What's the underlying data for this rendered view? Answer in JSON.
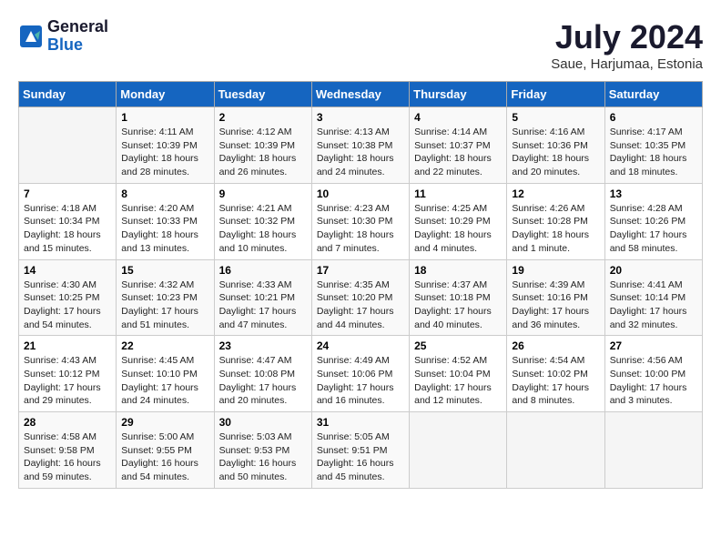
{
  "logo": {
    "line1": "General",
    "line2": "Blue"
  },
  "title": "July 2024",
  "location": "Saue, Harjumaa, Estonia",
  "days_header": [
    "Sunday",
    "Monday",
    "Tuesday",
    "Wednesday",
    "Thursday",
    "Friday",
    "Saturday"
  ],
  "weeks": [
    [
      {
        "day": "",
        "sunrise": "",
        "sunset": "",
        "daylight": ""
      },
      {
        "day": "1",
        "sunrise": "Sunrise: 4:11 AM",
        "sunset": "Sunset: 10:39 PM",
        "daylight": "Daylight: 18 hours and 28 minutes."
      },
      {
        "day": "2",
        "sunrise": "Sunrise: 4:12 AM",
        "sunset": "Sunset: 10:39 PM",
        "daylight": "Daylight: 18 hours and 26 minutes."
      },
      {
        "day": "3",
        "sunrise": "Sunrise: 4:13 AM",
        "sunset": "Sunset: 10:38 PM",
        "daylight": "Daylight: 18 hours and 24 minutes."
      },
      {
        "day": "4",
        "sunrise": "Sunrise: 4:14 AM",
        "sunset": "Sunset: 10:37 PM",
        "daylight": "Daylight: 18 hours and 22 minutes."
      },
      {
        "day": "5",
        "sunrise": "Sunrise: 4:16 AM",
        "sunset": "Sunset: 10:36 PM",
        "daylight": "Daylight: 18 hours and 20 minutes."
      },
      {
        "day": "6",
        "sunrise": "Sunrise: 4:17 AM",
        "sunset": "Sunset: 10:35 PM",
        "daylight": "Daylight: 18 hours and 18 minutes."
      }
    ],
    [
      {
        "day": "7",
        "sunrise": "Sunrise: 4:18 AM",
        "sunset": "Sunset: 10:34 PM",
        "daylight": "Daylight: 18 hours and 15 minutes."
      },
      {
        "day": "8",
        "sunrise": "Sunrise: 4:20 AM",
        "sunset": "Sunset: 10:33 PM",
        "daylight": "Daylight: 18 hours and 13 minutes."
      },
      {
        "day": "9",
        "sunrise": "Sunrise: 4:21 AM",
        "sunset": "Sunset: 10:32 PM",
        "daylight": "Daylight: 18 hours and 10 minutes."
      },
      {
        "day": "10",
        "sunrise": "Sunrise: 4:23 AM",
        "sunset": "Sunset: 10:30 PM",
        "daylight": "Daylight: 18 hours and 7 minutes."
      },
      {
        "day": "11",
        "sunrise": "Sunrise: 4:25 AM",
        "sunset": "Sunset: 10:29 PM",
        "daylight": "Daylight: 18 hours and 4 minutes."
      },
      {
        "day": "12",
        "sunrise": "Sunrise: 4:26 AM",
        "sunset": "Sunset: 10:28 PM",
        "daylight": "Daylight: 18 hours and 1 minute."
      },
      {
        "day": "13",
        "sunrise": "Sunrise: 4:28 AM",
        "sunset": "Sunset: 10:26 PM",
        "daylight": "Daylight: 17 hours and 58 minutes."
      }
    ],
    [
      {
        "day": "14",
        "sunrise": "Sunrise: 4:30 AM",
        "sunset": "Sunset: 10:25 PM",
        "daylight": "Daylight: 17 hours and 54 minutes."
      },
      {
        "day": "15",
        "sunrise": "Sunrise: 4:32 AM",
        "sunset": "Sunset: 10:23 PM",
        "daylight": "Daylight: 17 hours and 51 minutes."
      },
      {
        "day": "16",
        "sunrise": "Sunrise: 4:33 AM",
        "sunset": "Sunset: 10:21 PM",
        "daylight": "Daylight: 17 hours and 47 minutes."
      },
      {
        "day": "17",
        "sunrise": "Sunrise: 4:35 AM",
        "sunset": "Sunset: 10:20 PM",
        "daylight": "Daylight: 17 hours and 44 minutes."
      },
      {
        "day": "18",
        "sunrise": "Sunrise: 4:37 AM",
        "sunset": "Sunset: 10:18 PM",
        "daylight": "Daylight: 17 hours and 40 minutes."
      },
      {
        "day": "19",
        "sunrise": "Sunrise: 4:39 AM",
        "sunset": "Sunset: 10:16 PM",
        "daylight": "Daylight: 17 hours and 36 minutes."
      },
      {
        "day": "20",
        "sunrise": "Sunrise: 4:41 AM",
        "sunset": "Sunset: 10:14 PM",
        "daylight": "Daylight: 17 hours and 32 minutes."
      }
    ],
    [
      {
        "day": "21",
        "sunrise": "Sunrise: 4:43 AM",
        "sunset": "Sunset: 10:12 PM",
        "daylight": "Daylight: 17 hours and 29 minutes."
      },
      {
        "day": "22",
        "sunrise": "Sunrise: 4:45 AM",
        "sunset": "Sunset: 10:10 PM",
        "daylight": "Daylight: 17 hours and 24 minutes."
      },
      {
        "day": "23",
        "sunrise": "Sunrise: 4:47 AM",
        "sunset": "Sunset: 10:08 PM",
        "daylight": "Daylight: 17 hours and 20 minutes."
      },
      {
        "day": "24",
        "sunrise": "Sunrise: 4:49 AM",
        "sunset": "Sunset: 10:06 PM",
        "daylight": "Daylight: 17 hours and 16 minutes."
      },
      {
        "day": "25",
        "sunrise": "Sunrise: 4:52 AM",
        "sunset": "Sunset: 10:04 PM",
        "daylight": "Daylight: 17 hours and 12 minutes."
      },
      {
        "day": "26",
        "sunrise": "Sunrise: 4:54 AM",
        "sunset": "Sunset: 10:02 PM",
        "daylight": "Daylight: 17 hours and 8 minutes."
      },
      {
        "day": "27",
        "sunrise": "Sunrise: 4:56 AM",
        "sunset": "Sunset: 10:00 PM",
        "daylight": "Daylight: 17 hours and 3 minutes."
      }
    ],
    [
      {
        "day": "28",
        "sunrise": "Sunrise: 4:58 AM",
        "sunset": "Sunset: 9:58 PM",
        "daylight": "Daylight: 16 hours and 59 minutes."
      },
      {
        "day": "29",
        "sunrise": "Sunrise: 5:00 AM",
        "sunset": "Sunset: 9:55 PM",
        "daylight": "Daylight: 16 hours and 54 minutes."
      },
      {
        "day": "30",
        "sunrise": "Sunrise: 5:03 AM",
        "sunset": "Sunset: 9:53 PM",
        "daylight": "Daylight: 16 hours and 50 minutes."
      },
      {
        "day": "31",
        "sunrise": "Sunrise: 5:05 AM",
        "sunset": "Sunset: 9:51 PM",
        "daylight": "Daylight: 16 hours and 45 minutes."
      },
      {
        "day": "",
        "sunrise": "",
        "sunset": "",
        "daylight": ""
      },
      {
        "day": "",
        "sunrise": "",
        "sunset": "",
        "daylight": ""
      },
      {
        "day": "",
        "sunrise": "",
        "sunset": "",
        "daylight": ""
      }
    ]
  ]
}
